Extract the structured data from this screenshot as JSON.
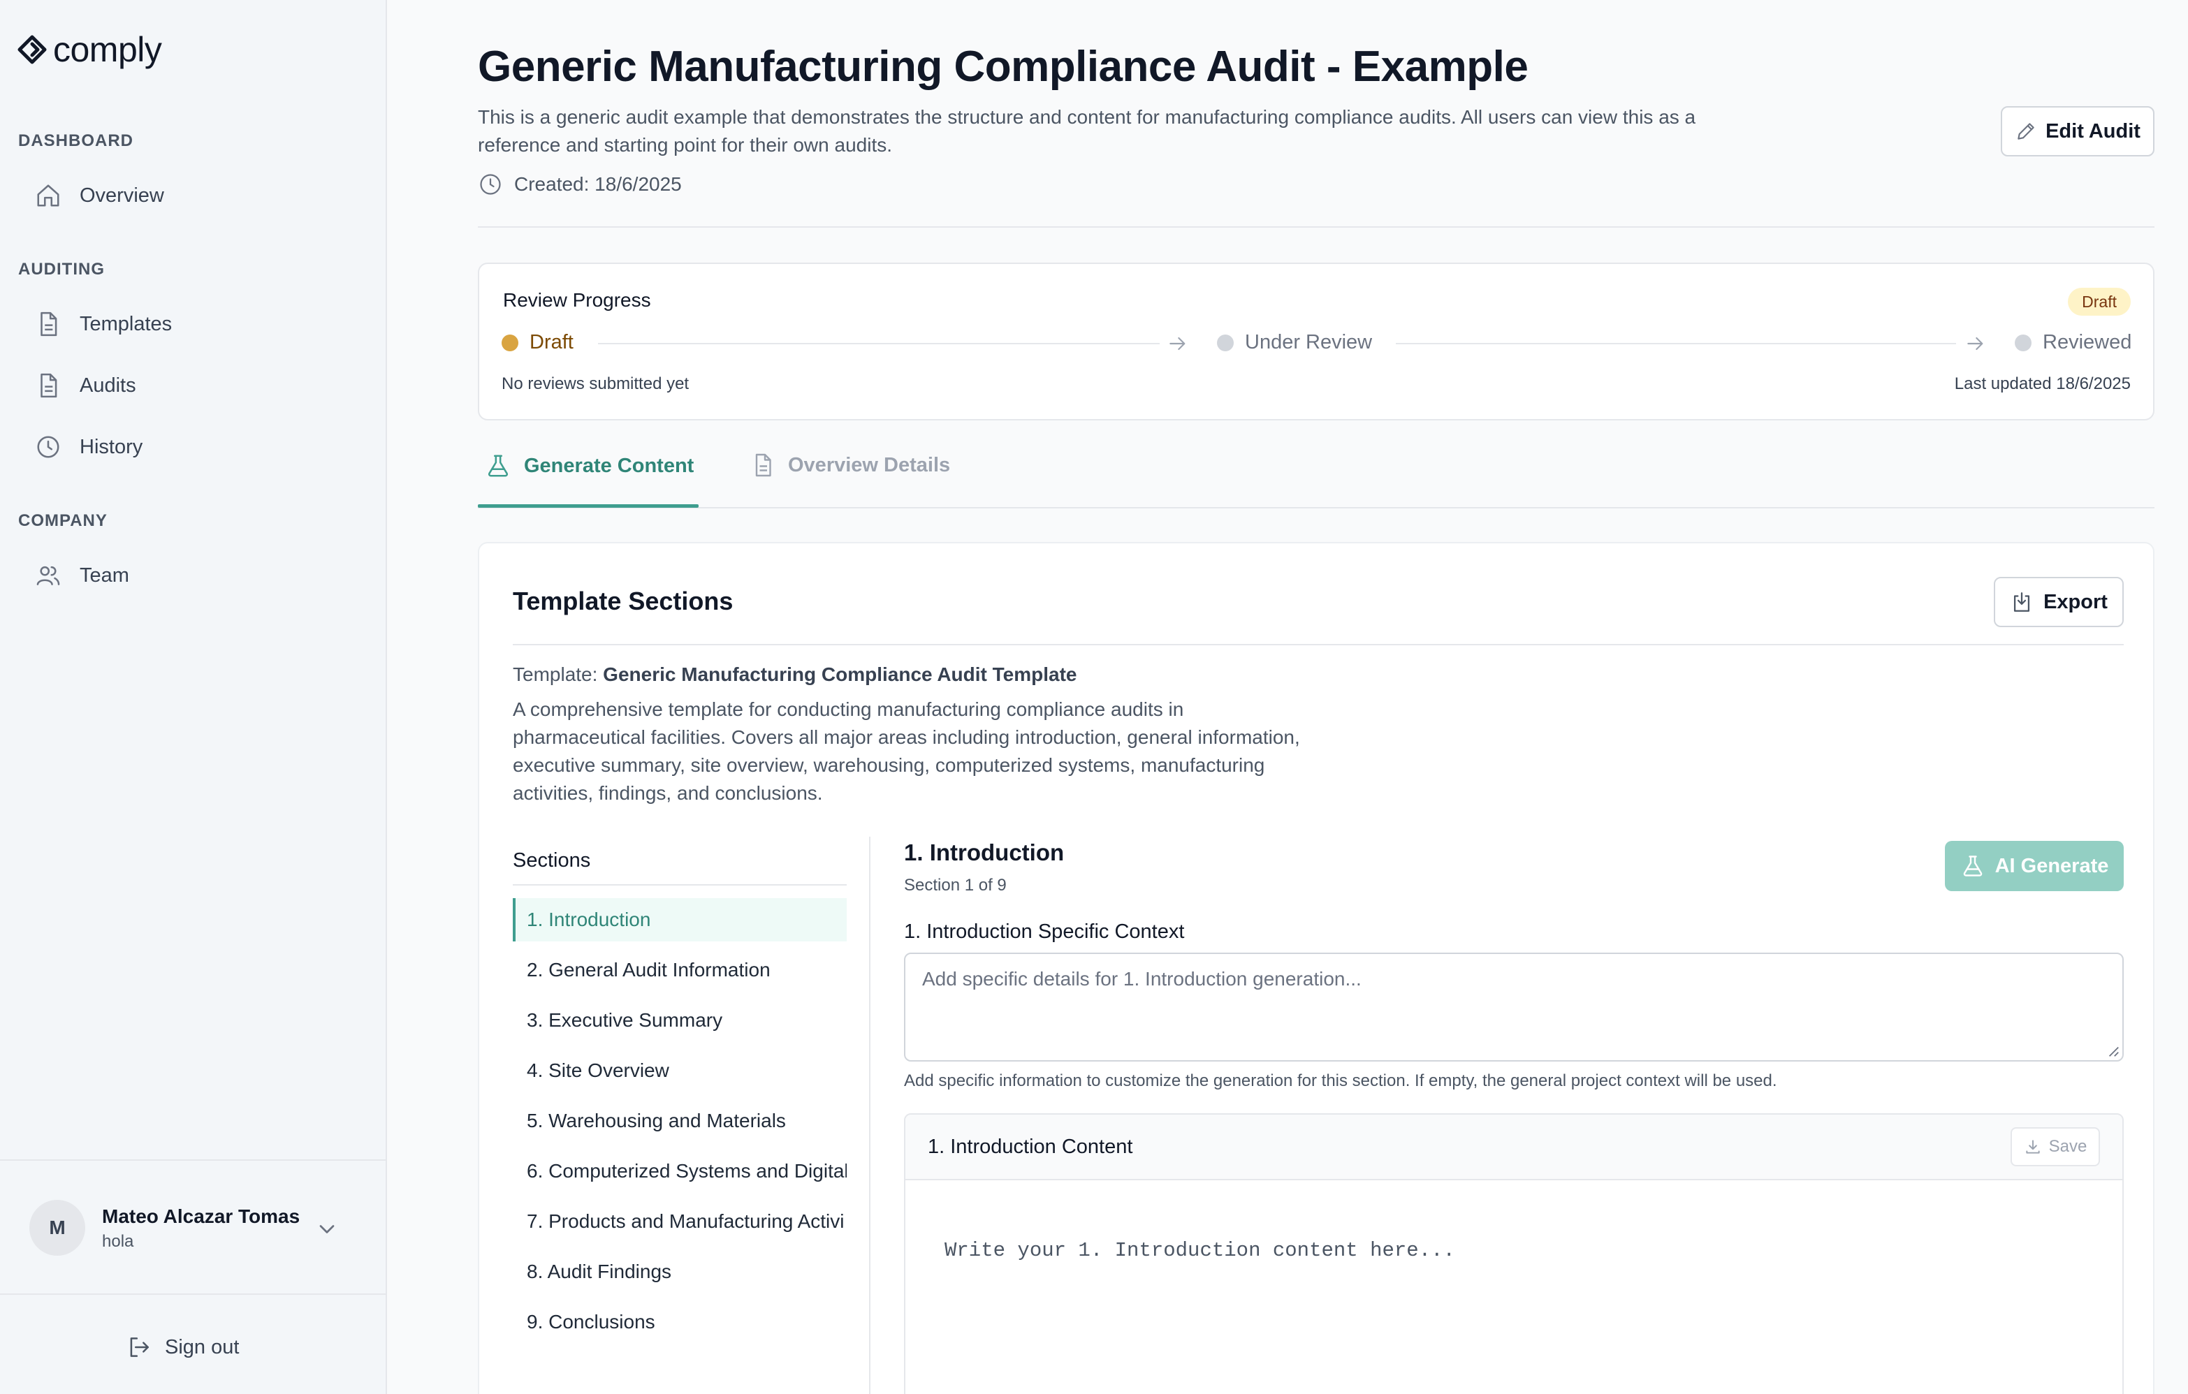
{
  "app": {
    "brand": "comply"
  },
  "sidebar": {
    "sections": [
      {
        "heading": "DASHBOARD",
        "items": [
          {
            "label": "Overview",
            "icon": "home-icon"
          }
        ]
      },
      {
        "heading": "AUDITING",
        "items": [
          {
            "label": "Templates",
            "icon": "file-icon"
          },
          {
            "label": "Audits",
            "icon": "file-icon"
          },
          {
            "label": "History",
            "icon": "clock-icon"
          }
        ]
      },
      {
        "heading": "COMPANY",
        "items": [
          {
            "label": "Team",
            "icon": "users-icon"
          }
        ]
      }
    ],
    "user": {
      "initial": "M",
      "name": "Mateo Alcazar Tomas",
      "subtitle": "hola"
    },
    "signout_label": "Sign out"
  },
  "header": {
    "title": "Generic Manufacturing Compliance Audit - Example",
    "description": "This is a generic audit example that demonstrates the structure and content for manufacturing compliance audits. All users can view this as a reference and starting point for their own audits.",
    "created": "Created: 18/6/2025",
    "edit_label": "Edit Audit"
  },
  "review": {
    "title": "Review Progress",
    "badge": "Draft",
    "steps": [
      {
        "label": "Draft",
        "state": "current"
      },
      {
        "label": "Under Review",
        "state": "pending"
      },
      {
        "label": "Reviewed",
        "state": "pending"
      }
    ],
    "note_left": "No reviews submitted yet",
    "note_right": "Last updated 18/6/2025"
  },
  "tabs": [
    {
      "label": "Generate Content",
      "active": true
    },
    {
      "label": "Overview Details",
      "active": false
    }
  ],
  "template_card": {
    "title": "Template Sections",
    "export_label": "Export",
    "template_prefix": "Template: ",
    "template_name": "Generic Manufacturing Compliance Audit Template",
    "template_desc": "A comprehensive template for conducting manufacturing compliance audits in pharmaceutical facilities. Covers all major areas including introduction, general information, executive summary, site overview, warehousing, computerized systems, manufacturing activities, findings, and conclusions.",
    "sections_heading": "Sections",
    "sections": [
      "1. Introduction",
      "2. General Audit Information",
      "3. Executive Summary",
      "4. Site Overview",
      "5. Warehousing and Materials",
      "6. Computerized Systems and Digital",
      "7. Products and Manufacturing Activi",
      "8. Audit Findings",
      "9. Conclusions"
    ],
    "active_section": 0
  },
  "section_detail": {
    "title": "1. Introduction",
    "subtitle": "Section 1 of 9",
    "ai_label": "AI Generate",
    "context_label": "1. Introduction Specific Context",
    "context_placeholder": "Add specific details for 1. Introduction generation...",
    "context_help": "Add specific information to customize the generation for this section. If empty, the general project context will be used.",
    "content_title": "1. Introduction Content",
    "save_label": "Save",
    "content_placeholder": "Write your 1. Introduction content here..."
  },
  "colors": {
    "accent": "#3f9e8f",
    "draft": "#d9a441",
    "pending": "#d1d5db"
  }
}
